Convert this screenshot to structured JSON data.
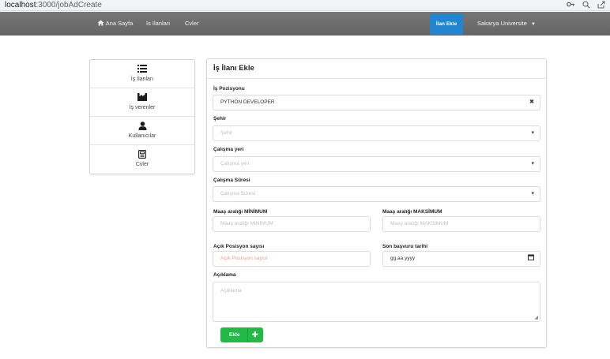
{
  "browser": {
    "url_host": "localhost",
    "url_path": ":3000/jobAdCreate",
    "icons": [
      "key-icon",
      "zoom-icon",
      "share-icon"
    ]
  },
  "navbar": {
    "home": "Ana Sayfa",
    "jobs": "Is Ilanlari",
    "cvs": "Cvler",
    "add_job": "İlan Ekle",
    "user": "Sakarya Universite",
    "bg_color": "#6e6e6e",
    "add_color": "#2185d0"
  },
  "sidebar": {
    "items": [
      {
        "label": "İş İlanları",
        "icon": "list-icon"
      },
      {
        "label": "İş verenler",
        "icon": "industry-icon"
      },
      {
        "label": "Kullanıcılar",
        "icon": "user-icon"
      },
      {
        "label": "Cvler",
        "icon": "document-icon"
      }
    ]
  },
  "form": {
    "title": "İş İlanı Ekle",
    "position": {
      "label": "İş Pozisyonu",
      "value": "PYTHON DEVELOPER"
    },
    "city": {
      "label": "Şehir",
      "placeholder": "Şehir"
    },
    "workplace": {
      "label": "Çalışma yeri",
      "placeholder": "Çalışma yeri"
    },
    "duration": {
      "label": "Çalışma Süresi",
      "placeholder": "Çalışma Süresi"
    },
    "salary_min": {
      "label": "Maaş aralığı MİNİMUM",
      "placeholder": "Maaş aralığı MİNİMUM"
    },
    "salary_max": {
      "label": "Maaş aralığı MAKSİMUM",
      "placeholder": "Maaş aralığı MAKSİMUM"
    },
    "open_positions": {
      "label": "Açık Posisyon sayısı",
      "placeholder": "Açık Posisyon sayısı"
    },
    "deadline": {
      "label": "Son başvuru tarihi",
      "value": "gg.aa.yyyy"
    },
    "description": {
      "label": "Açıklama",
      "placeholder": "Açıklama"
    },
    "submit": "Ekle",
    "submit_color": "#21ba45",
    "error_color": "#e8a0a0"
  }
}
